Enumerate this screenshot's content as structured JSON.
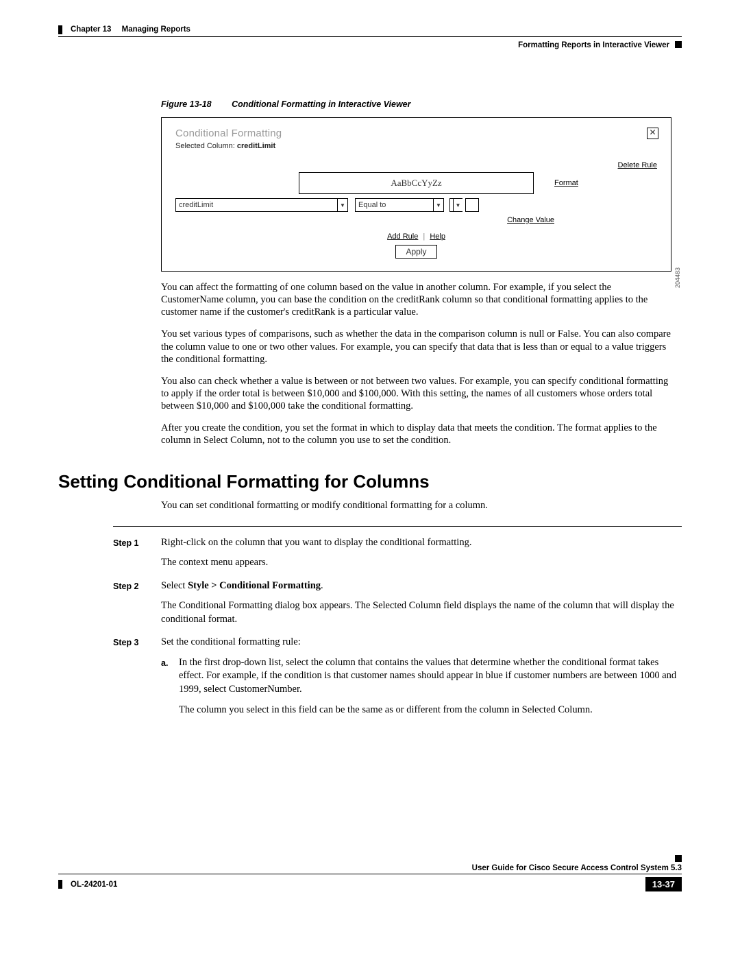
{
  "header": {
    "chapter_label": "Chapter 13",
    "chapter_title": "Managing Reports",
    "subheading": "Formatting Reports in Interactive Viewer"
  },
  "figure": {
    "number": "Figure 13-18",
    "title": "Conditional Formatting in Interactive Viewer",
    "id": "204483",
    "dialog": {
      "title": "Conditional Formatting",
      "selected_label": "Selected Column:",
      "selected_value": "creditLimit",
      "delete_rule": "Delete Rule",
      "sample_text": "AaBbCcYyZz",
      "format_link": "Format",
      "column_select": "creditLimit",
      "operator_select": "Equal to",
      "change_value": "Change Value",
      "add_rule": "Add Rule",
      "help": "Help",
      "apply": "Apply",
      "close_glyph": "✕"
    }
  },
  "paras": {
    "p1": "You can affect the formatting of one column based on the value in another column. For example, if you select the CustomerName column, you can base the condition on the creditRank column so that conditional formatting applies to the customer name if the customer's creditRank is a particular value.",
    "p2": "You set various types of comparisons, such as whether the data in the comparison column is null or False. You can also compare the column value to one or two other values. For example, you can specify that data that is less than or equal to a value triggers the conditional formatting.",
    "p3": "You also can check whether a value is between or not between two values. For example, you can specify conditional formatting to apply if the order total is between $10,000 and $100,000. With this setting, the names of all customers whose orders total between $10,000 and $100,000 take the conditional formatting.",
    "p4": "After you create the condition, you set the format in which to display data that meets the condition. The format applies to the column in Select Column, not to the column you use to set the condition."
  },
  "section_heading": "Setting Conditional Formatting for Columns",
  "section_intro": "You can set conditional formatting or modify conditional formatting for a column.",
  "steps": [
    {
      "label": "Step 1",
      "lines": [
        "Right-click on the column that you want to display the conditional formatting.",
        "The context menu appears."
      ]
    },
    {
      "label": "Step 2",
      "lines_html": "Select <b>Style &gt; Conditional Formatting</b>.",
      "lines_plain": "Select Style > Conditional Formatting.",
      "after": "The Conditional Formatting dialog box appears. The Selected Column field displays the name of the column that will display the conditional format."
    },
    {
      "label": "Step 3",
      "lines": [
        "Set the conditional formatting rule:"
      ],
      "sub": {
        "label": "a.",
        "text1": "In the first drop-down list, select the column that contains the values that determine whether the conditional format takes effect. For example, if the condition is that customer names should appear in blue if customer numbers are between 1000 and 1999, select CustomerNumber.",
        "text2": "The column you select in this field can be the same as or different from the column in Selected Column."
      }
    }
  ],
  "footer": {
    "guide": "User Guide for Cisco Secure Access Control System 5.3",
    "doc_id": "OL-24201-01",
    "page": "13-37"
  }
}
